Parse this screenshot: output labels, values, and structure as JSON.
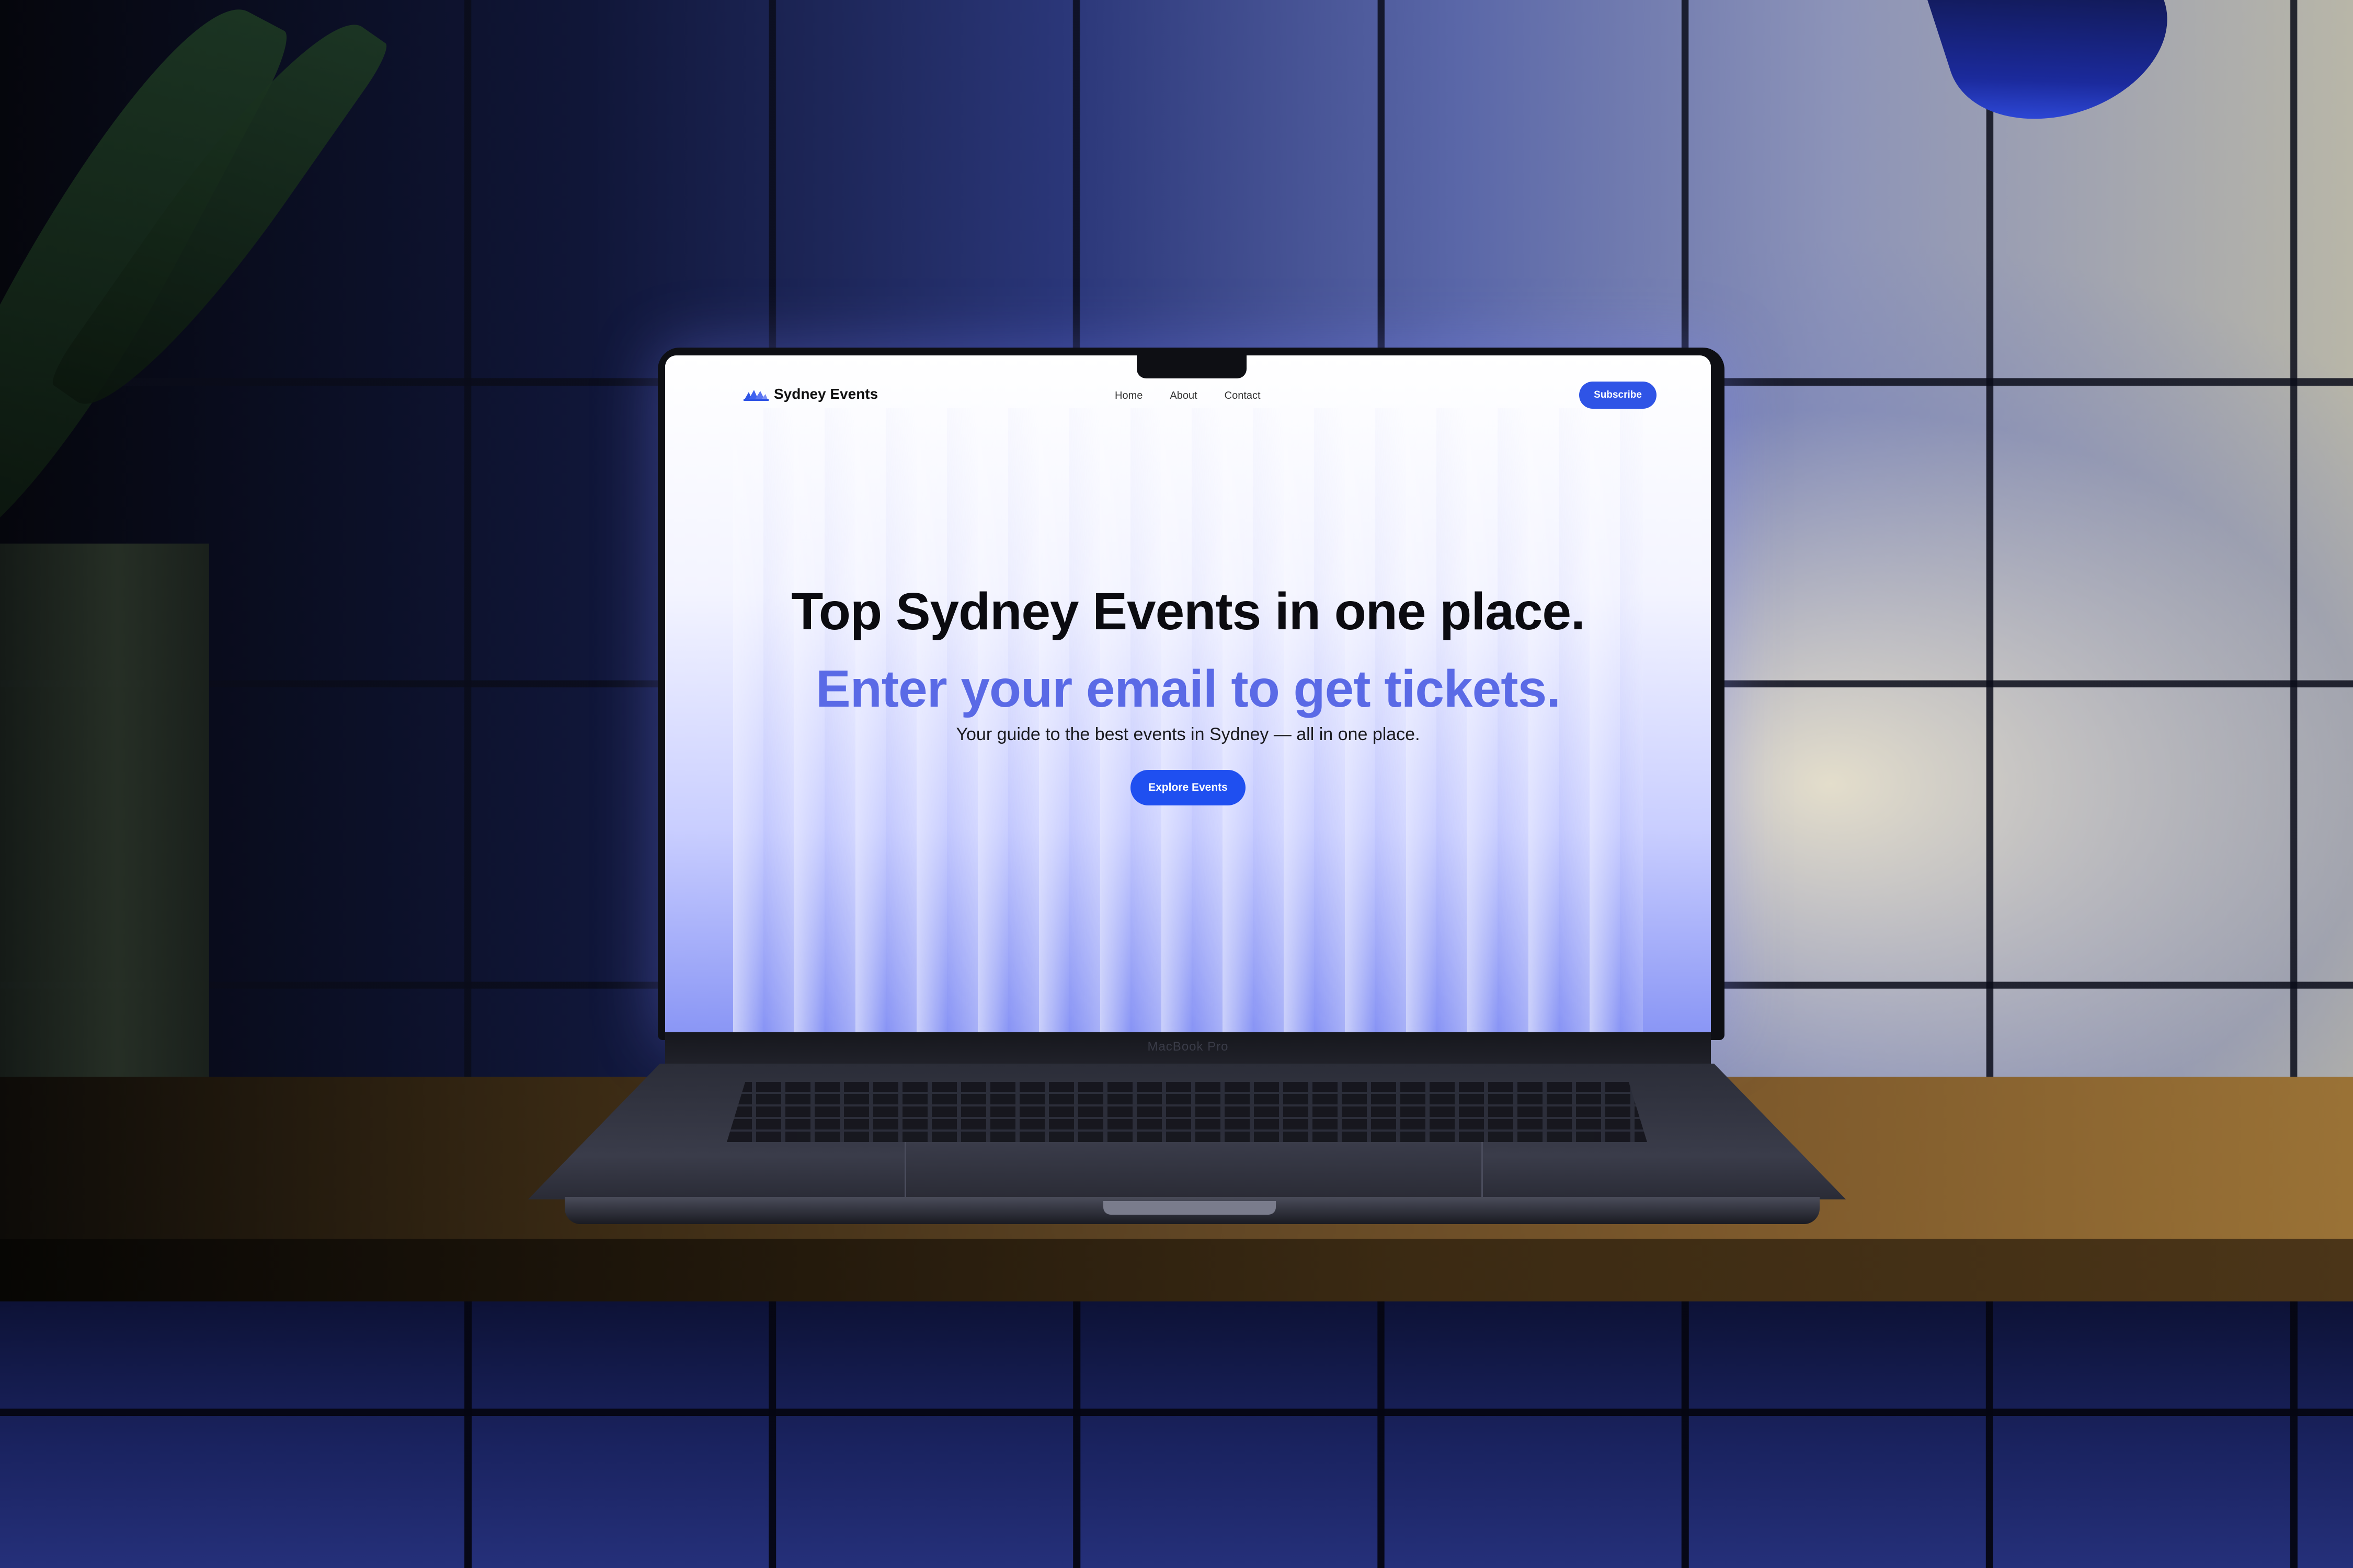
{
  "site": {
    "brand": {
      "name": "Sydney Events",
      "logo_icon": "opera-house-icon"
    },
    "nav": {
      "links": [
        "Home",
        "About",
        "Contact"
      ]
    },
    "subscribe_label": "Subscribe",
    "hero": {
      "title": "Top Sydney Events in one place.",
      "subtitle": "Enter your email to get tickets.",
      "description": "Your guide to the best events in Sydney — all in one place.",
      "cta_label": "Explore Events"
    },
    "colors": {
      "accent": "#2f54e6",
      "subtitle": "#5a6ae6",
      "cta": "#1f4ff0"
    }
  },
  "device": {
    "label": "MacBook Pro"
  }
}
